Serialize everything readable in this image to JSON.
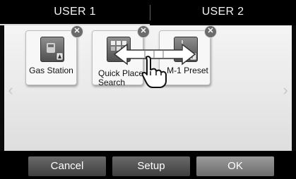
{
  "tabs": [
    {
      "label": "USER 1",
      "selected": true
    },
    {
      "label": "USER 2",
      "selected": false
    }
  ],
  "shortcuts": [
    {
      "label": "Gas Station",
      "icon": "gas-station-icon"
    },
    {
      "label_line1": "Quick Place",
      "label_line2": "Search",
      "icon": "quick-place-icon"
    },
    {
      "label": "M-1 Preset",
      "icon": "fm-preset-icon"
    }
  ],
  "close_glyph": "✕",
  "nav_arrows": {
    "left": "‹",
    "right": "›"
  },
  "buttons": {
    "cancel": "Cancel",
    "setup": "Setup",
    "ok": "OK"
  }
}
